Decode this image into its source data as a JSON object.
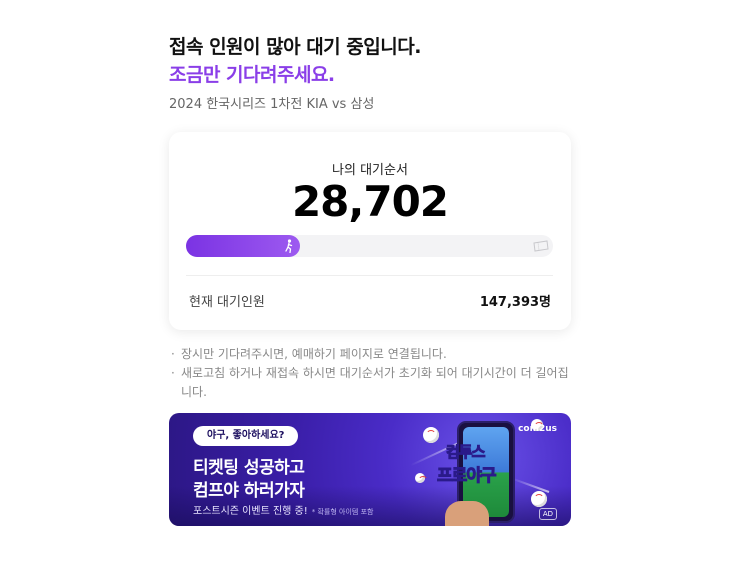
{
  "header": {
    "headline": "접속 인원이 많아 대기 중입니다.",
    "subline": "조금만 기다려주세요.",
    "event_title": "2024 한국시리즈 1차전 KIA vs 삼성"
  },
  "queue": {
    "label": "나의 대기순서",
    "position": "28,702",
    "progress_fraction": 0.31,
    "current_label": "현재 대기인원",
    "current_value": "147,393명",
    "runner_icon": "runner-icon",
    "ticket_icon": "ticket-icon"
  },
  "notices": [
    "장시만 기다려주시면, 예매하기 페이지로 연결됩니다.",
    "새로고침 하거나 재접속 하시면 대기순서가 초기화 되어 대기시간이 더 길어집니다."
  ],
  "banner": {
    "pill": "야구, 좋아하세요?",
    "line1": "티켓팅 성공하고",
    "line2": "컴프야 하러가자",
    "foot": "포스트시즌 이벤트 진행 중!",
    "foot_note": "* 확률형 아이템 포함",
    "brand": "com2us",
    "game_logo_1": "컴투스",
    "game_logo_2": "프로야구",
    "ad_badge": "AD"
  },
  "colors": {
    "accent": "#8a3ee8",
    "progress": "#7b33e3",
    "banner_bg": "#3a1ea8"
  }
}
